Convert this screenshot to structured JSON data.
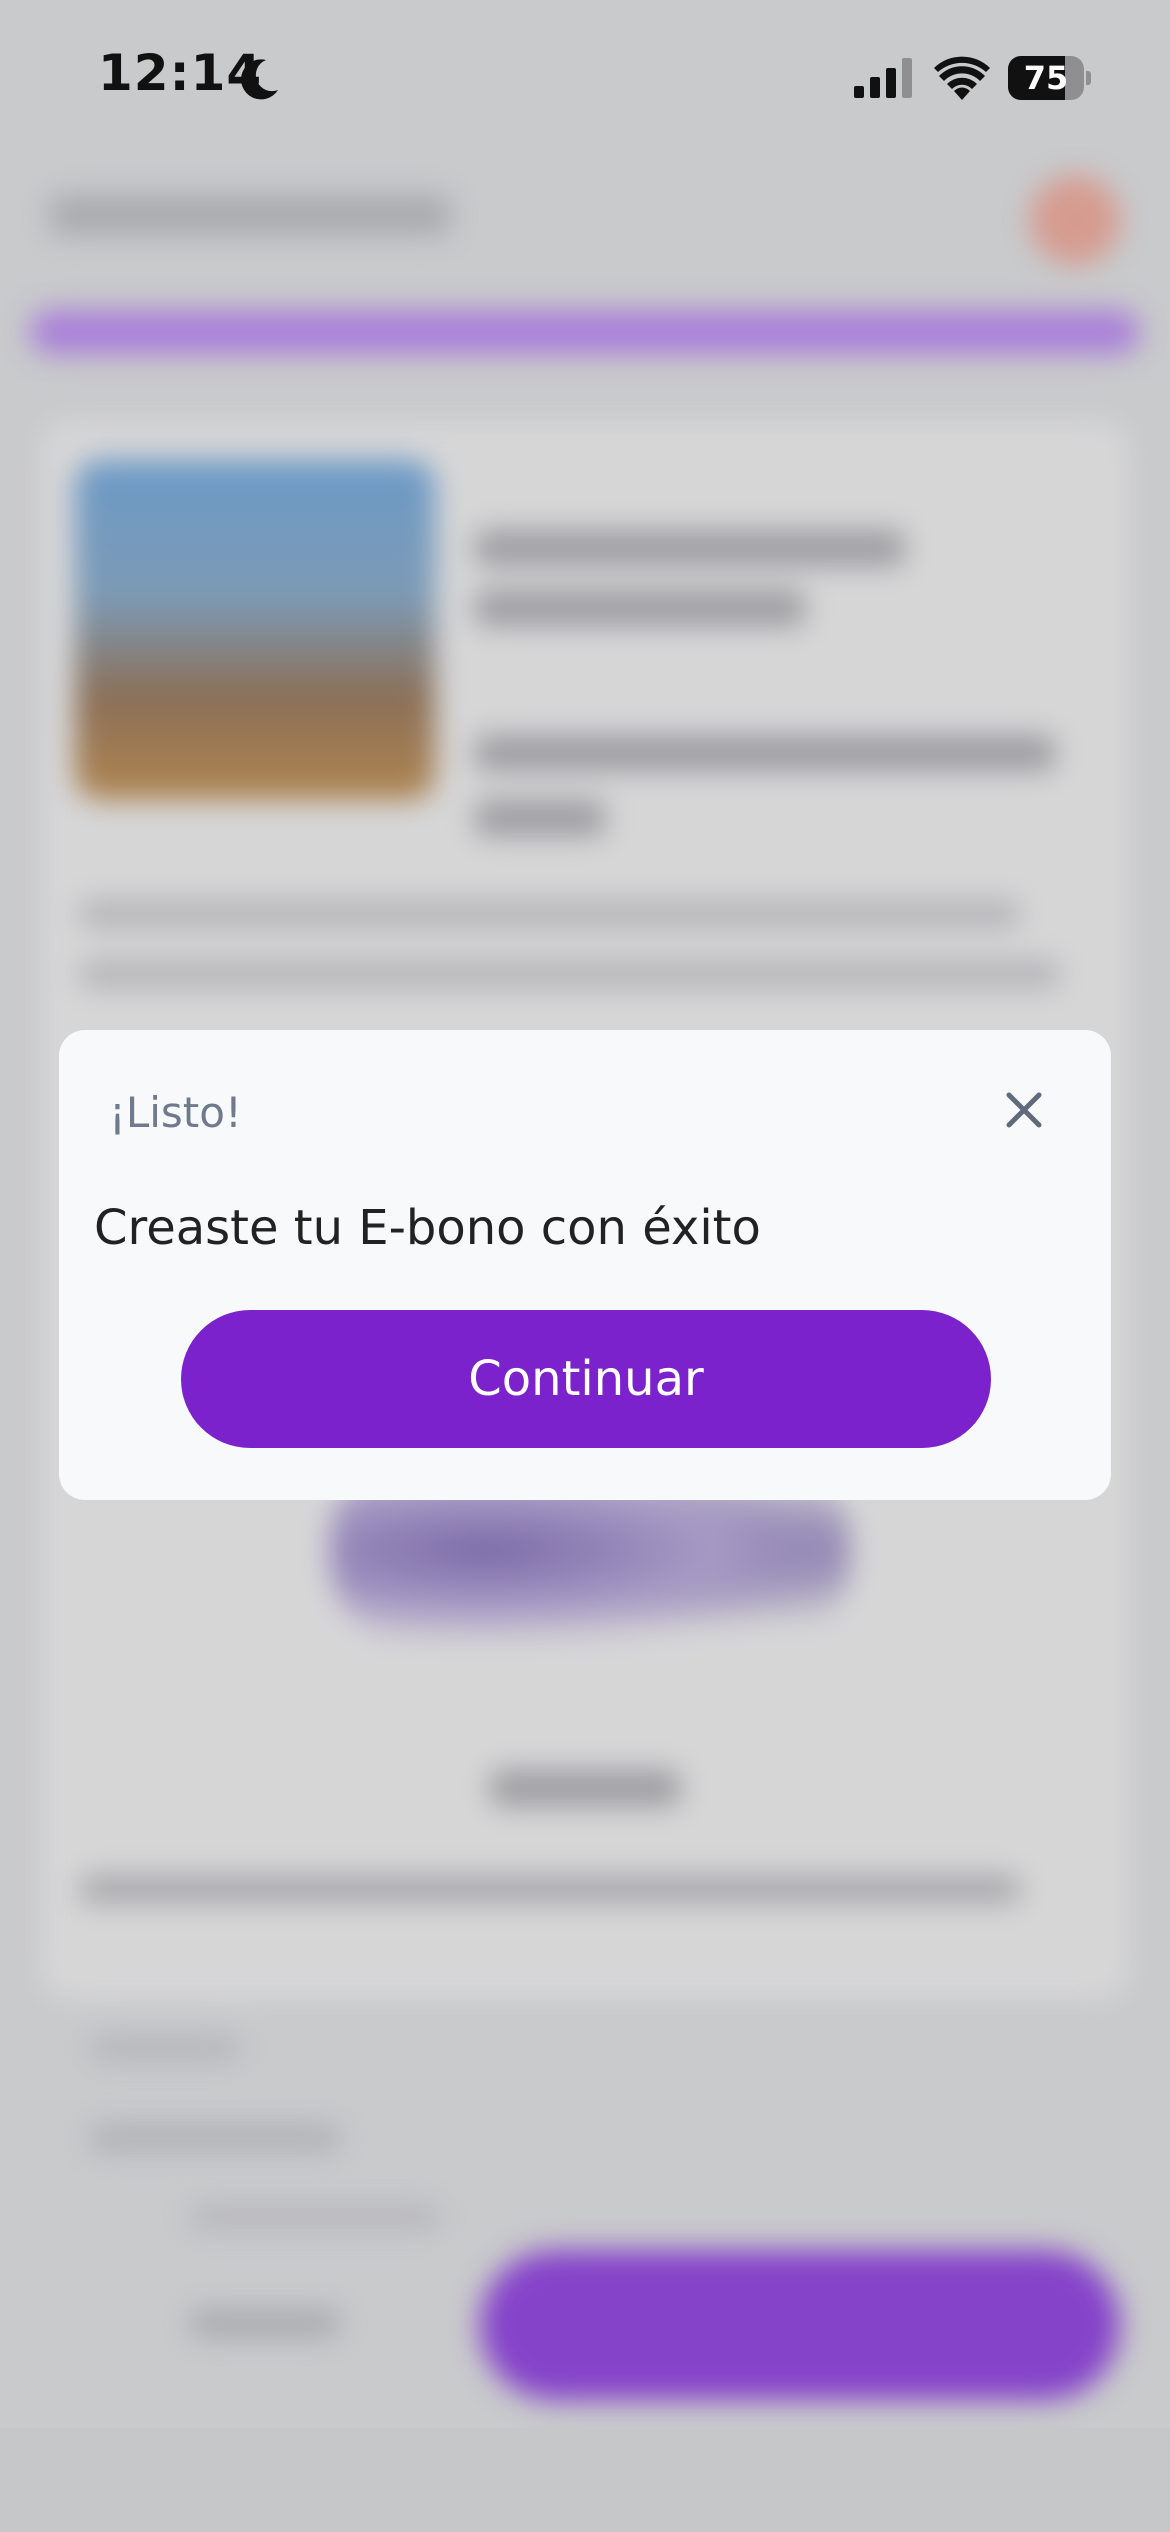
{
  "status_bar": {
    "time": "12:14",
    "focus_icon": "moon-icon",
    "signal_icon": "cellular-signal-icon",
    "wifi_icon": "wifi-icon",
    "battery_level": "75",
    "battery_fraction": 0.75
  },
  "modal": {
    "title": "¡Listo!",
    "close_icon": "close-icon",
    "message": "Creaste tu E-bono con éxito",
    "continue_label": "Continuar"
  },
  "colors": {
    "accent": "#7b22cc",
    "modal_background": "#f8f9fb",
    "overlay": "#c9cacc",
    "title_gray": "#6f7b8c"
  }
}
